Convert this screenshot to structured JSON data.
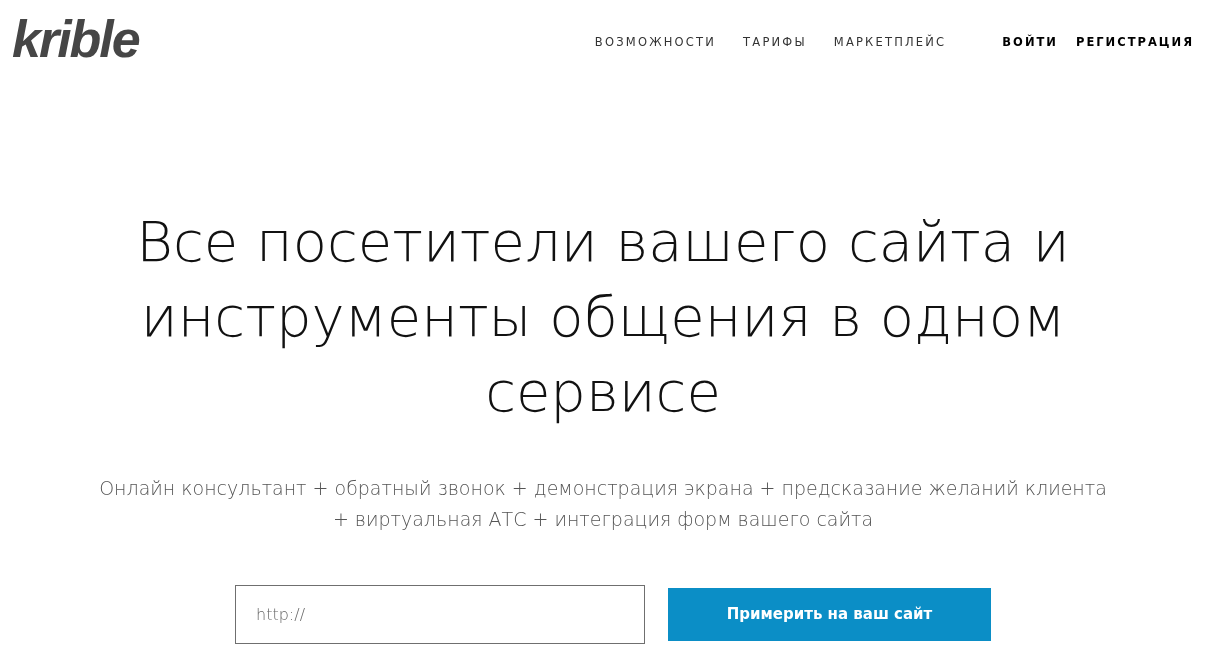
{
  "header": {
    "logo": "krible",
    "nav": [
      {
        "label": "ВОЗМОЖНОСТИ",
        "kind": "menu"
      },
      {
        "label": "ТАРИФЫ",
        "kind": "menu"
      },
      {
        "label": "МАРКЕТПЛЕЙС",
        "kind": "menu"
      },
      {
        "label": "ВОЙТИ",
        "kind": "account"
      },
      {
        "label": "РЕГИСТРАЦИЯ",
        "kind": "account"
      }
    ]
  },
  "hero": {
    "headline": "Все посетители вашего сайта и инструменты общения в одном сервисе",
    "subtitle": "Онлайн консультант + обратный звонок + демонстрация экрана + предсказание желаний клиента + виртуальная АТС + интеграция форм вашего сайта",
    "url_field": {
      "placeholder": "http://"
    },
    "submit_button": "Примерить на ваш сайт"
  }
}
